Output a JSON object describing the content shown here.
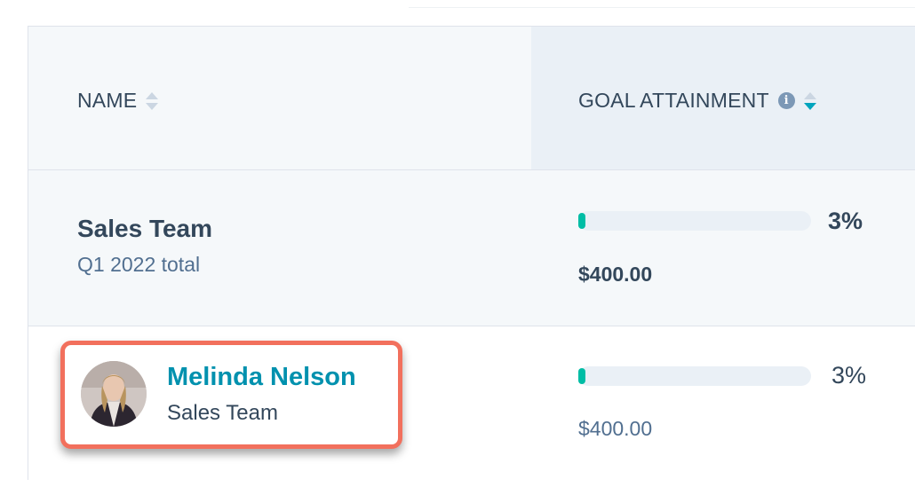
{
  "table": {
    "columns": {
      "name": {
        "label": "NAME",
        "sort": "none"
      },
      "goal": {
        "label": "GOAL ATTAINMENT",
        "sort": "descending",
        "info_icon": "info-icon"
      }
    },
    "rows": [
      {
        "type": "team",
        "name": "Sales Team",
        "subtitle": "Q1 2022 total",
        "progress_percent": 3,
        "percent_label": "3%",
        "amount": "$400.00"
      },
      {
        "type": "user",
        "name": "Melinda Nelson",
        "subtitle": "Sales Team",
        "avatar": "user-avatar",
        "progress_percent": 3,
        "percent_label": "3%",
        "amount": "$400.00",
        "highlighted": true
      }
    ]
  },
  "colors": {
    "accent_link": "#0091ae",
    "progress_fill": "#00bda5",
    "highlight_border": "#f2705d",
    "text_primary": "#33475b"
  }
}
